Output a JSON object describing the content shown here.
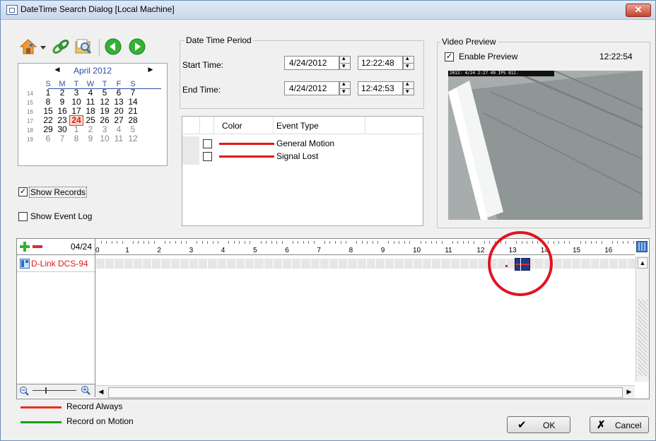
{
  "window": {
    "title": "DateTime Search Dialog  [Local Machine]",
    "close_glyph": "✕"
  },
  "toolbar": {
    "icons": [
      "home-icon",
      "dropdown-arrow-icon",
      "link-icon",
      "search-folder-icon",
      "prev-icon",
      "next-icon"
    ]
  },
  "calendar": {
    "month_label": "April 2012",
    "day_names": [
      "S",
      "M",
      "T",
      "W",
      "T",
      "F",
      "S"
    ],
    "weeks": [
      {
        "wk": "14",
        "days": [
          "1",
          "2",
          "3",
          "4",
          "5",
          "6",
          "7"
        ],
        "other": [
          false,
          false,
          false,
          false,
          false,
          false,
          false
        ]
      },
      {
        "wk": "15",
        "days": [
          "8",
          "9",
          "10",
          "11",
          "12",
          "13",
          "14"
        ],
        "other": [
          false,
          false,
          false,
          false,
          false,
          false,
          false
        ]
      },
      {
        "wk": "16",
        "days": [
          "15",
          "16",
          "17",
          "18",
          "19",
          "20",
          "21"
        ],
        "other": [
          false,
          false,
          false,
          false,
          false,
          false,
          false
        ]
      },
      {
        "wk": "17",
        "days": [
          "22",
          "23",
          "24",
          "25",
          "26",
          "27",
          "28"
        ],
        "other": [
          false,
          false,
          false,
          false,
          false,
          false,
          false
        ]
      },
      {
        "wk": "18",
        "days": [
          "29",
          "30",
          "1",
          "2",
          "3",
          "4",
          "5"
        ],
        "other": [
          false,
          false,
          true,
          true,
          true,
          true,
          true
        ]
      },
      {
        "wk": "19",
        "days": [
          "6",
          "7",
          "8",
          "9",
          "10",
          "11",
          "12"
        ],
        "other": [
          true,
          true,
          true,
          true,
          true,
          true,
          true
        ]
      }
    ],
    "selected_day": "24"
  },
  "options": {
    "show_records": "Show Records",
    "show_records_checked": true,
    "show_event_log": "Show Event Log",
    "show_event_log_checked": false
  },
  "period": {
    "group_title": "Date Time Period",
    "start_label": "Start Time:",
    "start_date": "4/24/2012",
    "start_time": "12:22:48",
    "end_label": "End Time:",
    "end_date": "4/24/2012",
    "end_time": "12:42:53"
  },
  "events": {
    "col_color": "Color",
    "col_type": "Event Type",
    "rows": [
      {
        "type": "General Motion",
        "color": "#e01818"
      },
      {
        "type": "Signal Lost",
        "color": "#e01818"
      }
    ]
  },
  "preview": {
    "group_title": "Video Preview",
    "enable_label": "Enable Preview",
    "enabled": true,
    "time": "12:22:54",
    "overlay": "2012: 4/24  2:27 49 IPS 812."
  },
  "timeline": {
    "date": "04/24",
    "hours": [
      "0",
      "1",
      "2",
      "3",
      "4",
      "5",
      "6",
      "7",
      "8",
      "9",
      "10",
      "11",
      "12",
      "13",
      "14",
      "15",
      "16"
    ],
    "camera": "D-Link DCS-94"
  },
  "legend": [
    {
      "label": "Record Always",
      "color": "#e8311c"
    },
    {
      "label": "Record on Motion",
      "color": "#14a014"
    }
  ],
  "buttons": {
    "ok": "OK",
    "cancel": "Cancel"
  }
}
